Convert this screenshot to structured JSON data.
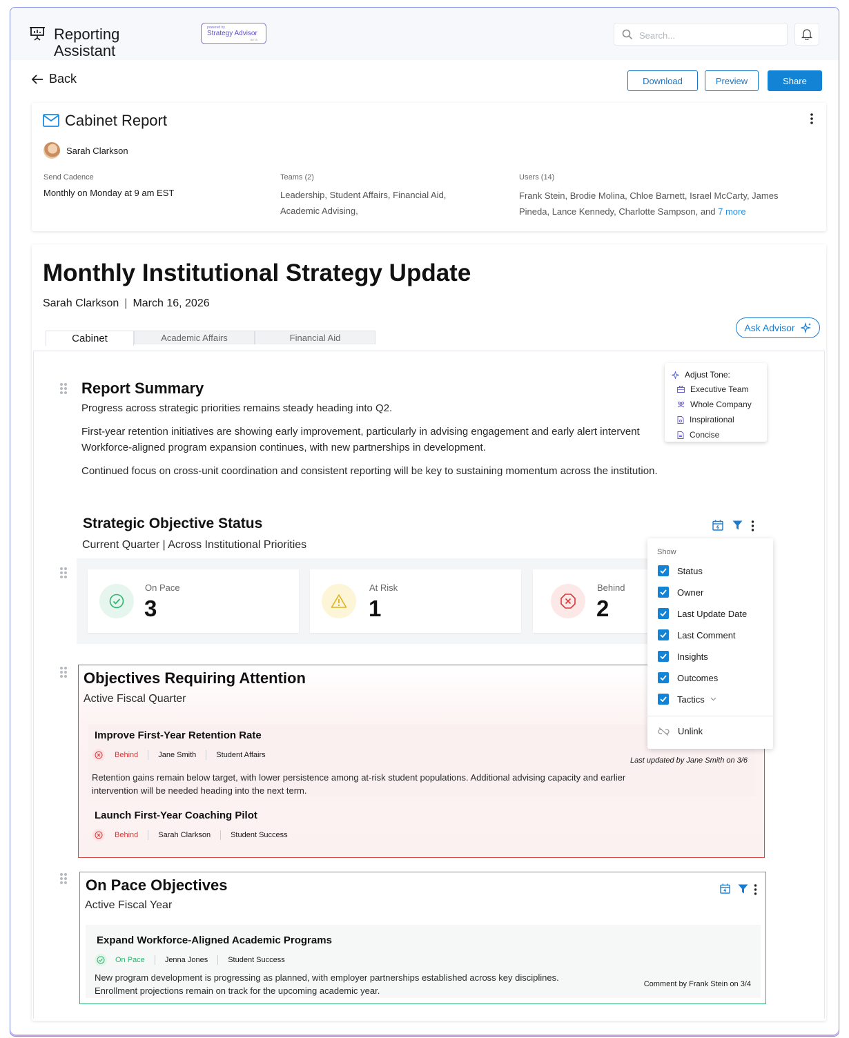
{
  "app": {
    "title": "Reporting Assistant",
    "badge_powered": "powered by",
    "badge_name": "Strategy Advisor",
    "badge_tag": "BETA"
  },
  "search": {
    "placeholder": "Search..."
  },
  "nav": {
    "back": "Back"
  },
  "actions": {
    "download": "Download",
    "preview": "Preview",
    "share": "Share"
  },
  "report_card": {
    "title": "Cabinet Report",
    "owner": "Sarah Clarkson",
    "cadence_label": "Send Cadence",
    "cadence_value": "Monthly on Monday at 9 am EST",
    "teams_label": "Teams (2)",
    "teams_value": "Leadership, Student Affairs, Financial Aid, Academic Advising,",
    "users_label": "Users (14)",
    "users_value": "Frank Stein, Brodie Molina, Chloe Barnett, Israel McCarty, James Pineda, Lance Kennedy, Charlotte Sampson, and",
    "users_more": "7 more"
  },
  "report": {
    "title": "Monthly Institutional Strategy Update",
    "author": "Sarah Clarkson",
    "date": "March 16, 2026",
    "ask_advisor": "Ask Advisor",
    "tabs": [
      "Cabinet",
      "Academic Affairs",
      "Financial Aid"
    ]
  },
  "summary": {
    "heading": "Report Summary",
    "p1": "Progress across strategic priorities remains steady heading into Q2.",
    "p2a": "First-year retention initiatives are showing early improvement, particularly in advising engagement and early alert intervent",
    "p2b": "Workforce-aligned program expansion continues, with new partnerships in development.",
    "p3": "Continued focus on cross-unit coordination and consistent reporting will be key to sustaining momentum across the institution."
  },
  "tone_menu": {
    "heading": "Adjust Tone:",
    "items": [
      "Executive Team",
      "Whole Company",
      "Inspirational",
      "Concise"
    ]
  },
  "status_section": {
    "heading": "Strategic Objective Status",
    "subheading": "Current Quarter | Across Institutional Priorities",
    "stats": [
      {
        "label": "On Pace",
        "value": "3",
        "color": "#2fb56e"
      },
      {
        "label": "At Risk",
        "value": "1",
        "color": "#e0b21e"
      },
      {
        "label": "Behind",
        "value": "2",
        "color": "#d93838"
      }
    ]
  },
  "show_menu": {
    "heading": "Show",
    "options": [
      "Status",
      "Owner",
      "Last Update Date",
      "Last Comment",
      "Insights",
      "Outcomes",
      "Tactics"
    ],
    "unlink": "Unlink"
  },
  "attention": {
    "heading": "Objectives Requiring Attention",
    "subheading": "Active Fiscal Quarter",
    "items": [
      {
        "title": "Improve First-Year Retention Rate",
        "status": "Behind",
        "owner": "Jane Smith",
        "team": "Student Affairs",
        "updated": "Last updated by Jane Smith on 3/6",
        "desc1": "Retention gains remain below target, with lower persistence among at-risk student populations. Additional advising capacity and earlier",
        "desc2": "intervention will be needed heading into the next term."
      },
      {
        "title": "Launch First-Year Coaching Pilot",
        "status": "Behind",
        "owner": "Sarah Clarkson",
        "team": "Student Success"
      }
    ]
  },
  "onpace": {
    "heading": "On Pace Objectives",
    "subheading": "Active Fiscal Year",
    "items": [
      {
        "title": "Expand Workforce-Aligned Academic Programs",
        "status": "On Pace",
        "owner": "Jenna Jones",
        "team": "Student Success",
        "desc1": "New program development is progressing as planned, with employer partnerships established across key disciplines.",
        "desc2": "Enrollment projections remain on track for the upcoming academic year.",
        "comment": "Comment by Frank Stein on 3/4"
      }
    ]
  },
  "colors": {
    "accent": "#1383d6",
    "behind": "#d93838",
    "on_pace": "#2fb56e",
    "at_risk": "#e0b21e"
  }
}
